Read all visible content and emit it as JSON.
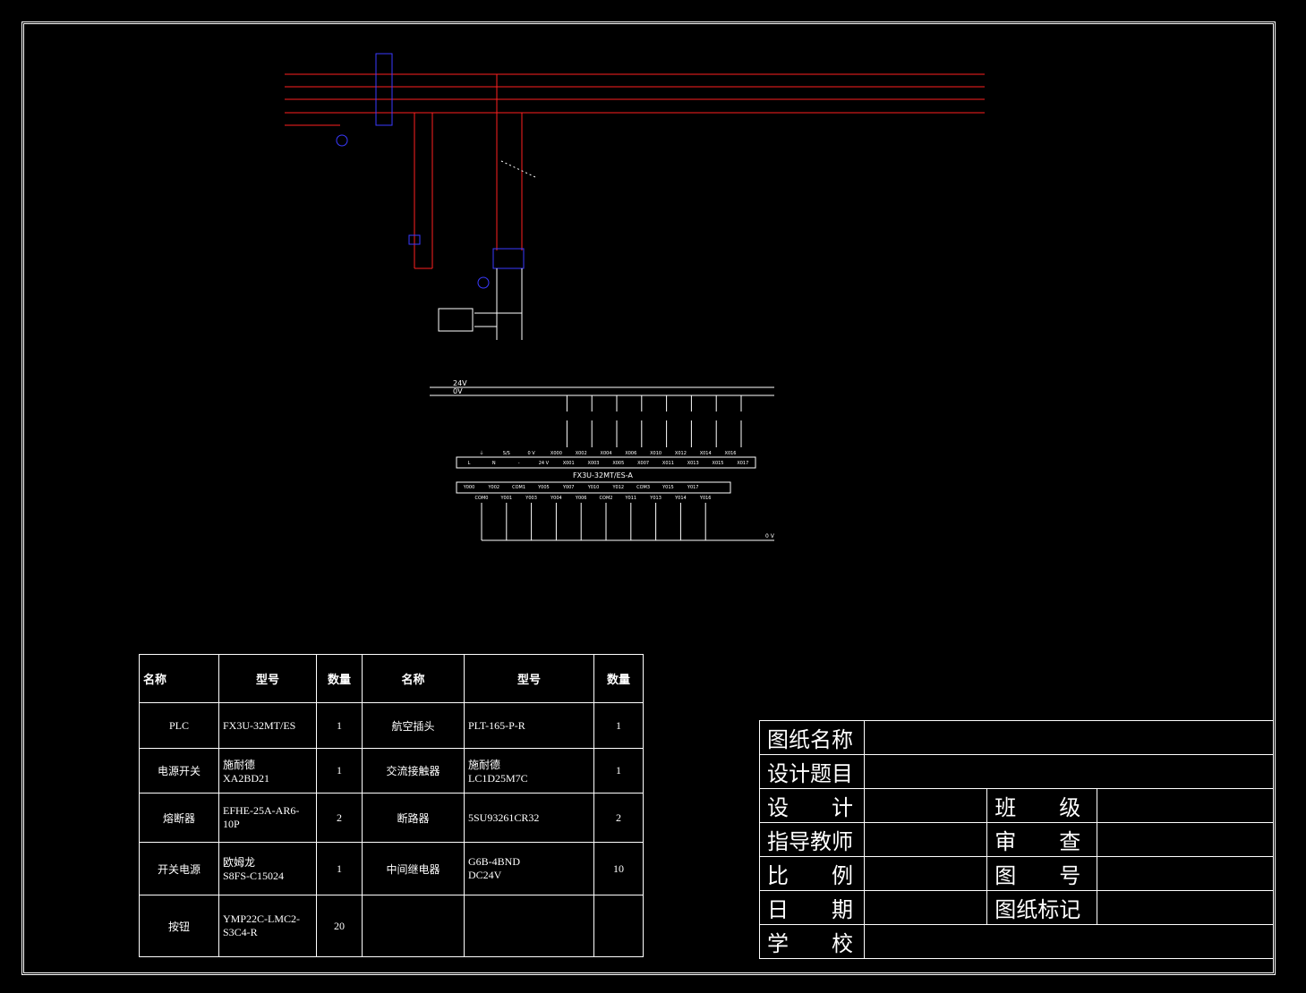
{
  "top_diagram": {
    "labels": {
      "fx3u": "FX3U-32MT/ES-A",
      "rail_24v": "24V",
      "rail_0v": "0V",
      "bottom_0v": "0 V"
    },
    "input_terminals": [
      "L",
      "N",
      "-",
      "24 V",
      "X001",
      "X003",
      "X005",
      "X007",
      "X011",
      "X013",
      "X015",
      "X017"
    ],
    "input_upper": [
      "⏚",
      "S/S",
      "0 V",
      "X000",
      "X002",
      "X004",
      "X006",
      "X010",
      "X012",
      "X014",
      "X016"
    ],
    "output_terminals": [
      "Y000",
      "Y002",
      "COM1",
      "Y005",
      "Y007",
      "Y010",
      "Y012",
      "COM3",
      "Y015",
      "Y017"
    ],
    "output_lower": [
      "COM0",
      "Y001",
      "Y003",
      "Y004",
      "Y006",
      "COM2",
      "Y011",
      "Y013",
      "Y014",
      "Y016"
    ]
  },
  "bom": {
    "headers": [
      "名称",
      "型号",
      "数量",
      "名称",
      "型号",
      "数量"
    ],
    "rows": [
      [
        "PLC",
        "FX3U-32MT/ES",
        "1",
        "航空插头",
        "PLT-165-P-R",
        "1"
      ],
      [
        "电源开关",
        "施耐德\nXA2BD21",
        "1",
        "交流接触器",
        "施耐德\nLC1D25M7C",
        "1"
      ],
      [
        "熔断器",
        "EFHE-25A-AR6-10P",
        "2",
        "断路器",
        "5SU93261CR32",
        "2"
      ],
      [
        "开关电源",
        "欧姆龙\nS8FS-C15024",
        "1",
        "中间继电器",
        "G6B-4BND\nDC24V",
        "10"
      ],
      [
        "按钮",
        "YMP22C-LMC2-\nS3C4-R",
        "20",
        "",
        "",
        ""
      ]
    ]
  },
  "title_block": {
    "drawing_name": "图纸名称",
    "design_topic": "设计题目",
    "design": "设　　计",
    "class": "班　　级",
    "advisor": "指导教师",
    "review": "审　　查",
    "scale": "比　　例",
    "drawing_no": "图　　号",
    "date": "日　　期",
    "drawing_mark": "图纸标记",
    "school": "学　　校"
  },
  "colors": {
    "wire_red": "#ff2020",
    "label_blue": "#3a3aff",
    "white": "#ffffff",
    "yellow": "#ffff60"
  }
}
